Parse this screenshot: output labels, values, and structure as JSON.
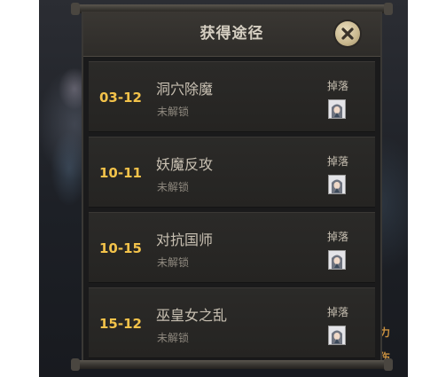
{
  "dialog": {
    "title": "获得途径",
    "close_icon": "close-x-icon"
  },
  "routes": [
    {
      "stage": "03-12",
      "name": "洞穴除魔",
      "status": "未解锁",
      "drop_label": "掉落",
      "avatar_icon": "hero-portrait-icon"
    },
    {
      "stage": "10-11",
      "name": "妖魔反攻",
      "status": "未解锁",
      "drop_label": "掉落",
      "avatar_icon": "hero-portrait-icon"
    },
    {
      "stage": "10-15",
      "name": "对抗国师",
      "status": "未解锁",
      "drop_label": "掉落",
      "avatar_icon": "hero-portrait-icon"
    },
    {
      "stage": "15-12",
      "name": "巫皇女之乱",
      "status": "未解锁",
      "drop_label": "掉落",
      "avatar_icon": "hero-portrait-icon"
    }
  ],
  "background_hints": [
    "击力",
    "击伤"
  ],
  "colors": {
    "stage_text": "#f2c24a",
    "panel_bg": "#1a1a1b",
    "row_bg": "#2b2a28",
    "close_button": "#c9b88e"
  }
}
